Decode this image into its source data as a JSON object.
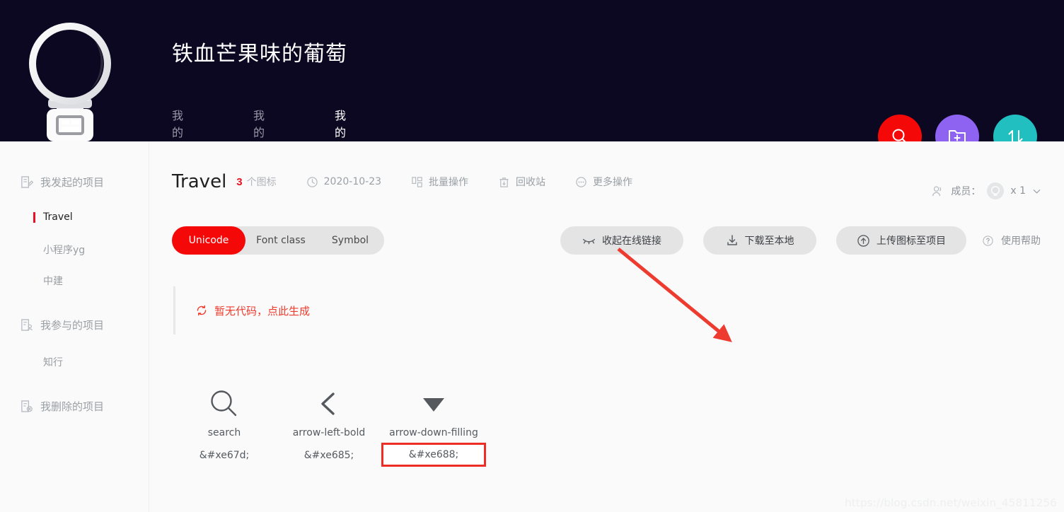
{
  "header": {
    "site_title": "铁血芒果味的葡萄",
    "avatar_icon": "astronaut-helmet-avatar",
    "background_color": "#0d0822",
    "nav": [
      {
        "label": "我的资源",
        "active": false
      },
      {
        "label": "我的收藏",
        "active": false
      },
      {
        "label": "我的项目",
        "active": true
      }
    ],
    "buttons": [
      {
        "name": "search-button",
        "icon": "search-icon",
        "color": "#f50808"
      },
      {
        "name": "new-project-button",
        "icon": "folder-plus-icon",
        "color": "#8e63f2"
      },
      {
        "name": "sort-button",
        "icon": "up-down-arrows-icon",
        "color": "#21bfbf"
      }
    ],
    "active_tab_underline_color": "#e81123"
  },
  "sidebar": {
    "groups": [
      {
        "label": "我发起的项目",
        "icon": "project-edit-icon",
        "items": [
          {
            "label": "Travel",
            "active": true
          },
          {
            "label": "小程序yg",
            "active": false
          },
          {
            "label": "中建",
            "active": false
          }
        ]
      },
      {
        "label": "我参与的项目",
        "icon": "project-member-icon",
        "items": [
          {
            "label": "知行",
            "active": false
          }
        ]
      },
      {
        "label": "我删除的项目",
        "icon": "project-delete-icon",
        "items": []
      }
    ]
  },
  "main": {
    "project_title": "Travel",
    "icon_count": "3",
    "icon_count_unit": "个图标",
    "icon_count_color": "#e81123",
    "meta": [
      {
        "name": "date",
        "icon": "clock-icon",
        "label": "2020-10-23"
      },
      {
        "name": "batch-operation",
        "icon": "batch-grid-icon",
        "label": "批量操作"
      },
      {
        "name": "recycle-bin",
        "icon": "trash-icon",
        "label": "回收站"
      },
      {
        "name": "more-operations",
        "icon": "ellipsis-circle-icon",
        "label": "更多操作"
      }
    ],
    "members": {
      "icon": "members-icon",
      "label": "成员：",
      "count": "x 1",
      "chevron": "chevron-down-icon"
    },
    "segmented": [
      {
        "label": "Unicode",
        "active": true
      },
      {
        "label": "Font class",
        "active": false
      },
      {
        "label": "Symbol",
        "active": false
      }
    ],
    "segmented_active_color": "#f50808",
    "actions": [
      {
        "name": "collapse-online-link-button",
        "icon": "eye-closed-icon",
        "label": "收起在线链接"
      },
      {
        "name": "download-local-button",
        "icon": "download-icon",
        "label": "下载至本地"
      },
      {
        "name": "upload-icon-button",
        "icon": "cloud-upload-icon",
        "label": "上传图标至项目"
      }
    ],
    "help": {
      "icon": "question-circle-icon",
      "label": "使用帮助"
    },
    "code_notice": {
      "icon": "refresh-icon",
      "label": "暂无代码，点此生成",
      "color": "#f03b2d"
    },
    "icons": [
      {
        "glyph": "search-icon",
        "name": "search",
        "code": "&#xe67d;",
        "highlight": false
      },
      {
        "glyph": "arrow-left-bold-icon",
        "name": "arrow-left-bold",
        "code": "&#xe685;",
        "highlight": false
      },
      {
        "glyph": "arrow-down-filling-icon",
        "name": "arrow-down-filling",
        "code": "&#xe688;",
        "highlight": true
      }
    ]
  },
  "annotations": {
    "arrow_color": "#ee3b30",
    "highlight_box_color": "#ee2d24"
  },
  "watermark": "https://blog.csdn.net/weixin_45811256"
}
